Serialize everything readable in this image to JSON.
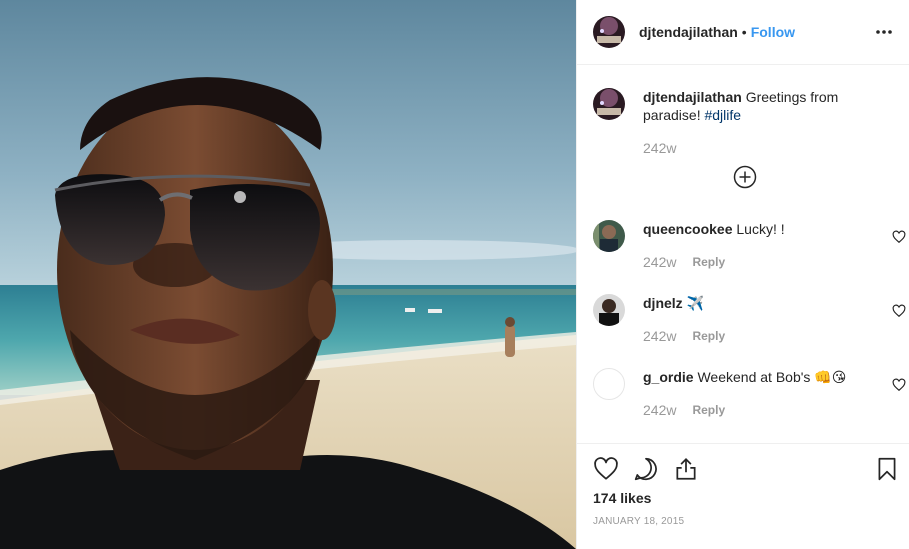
{
  "header": {
    "username": "djtendajilathan",
    "separator": "•",
    "follow_label": "Follow"
  },
  "caption": {
    "username": "djtendajilathan",
    "text": "Greetings from paradise!",
    "hashtag": "#djlife",
    "time": "242w"
  },
  "comments": [
    {
      "username": "queencookee",
      "text": "Lucky! !",
      "time": "242w",
      "reply_label": "Reply"
    },
    {
      "username": "djnelz",
      "text": "✈️",
      "time": "242w",
      "reply_label": "Reply"
    },
    {
      "username": "g_ordie",
      "text": "Weekend at Bob's 👊😘",
      "time": "242w",
      "reply_label": "Reply"
    }
  ],
  "likes": "174 likes",
  "date": "JANUARY 18, 2015",
  "icons": {
    "more": "more-options-icon",
    "load_more": "plus-circle-icon",
    "like": "heart-icon",
    "comment": "comment-icon",
    "share": "share-icon",
    "save": "bookmark-icon"
  },
  "colors": {
    "link": "#3897f0",
    "hashtag": "#003569",
    "muted": "#999999",
    "text": "#262626"
  }
}
